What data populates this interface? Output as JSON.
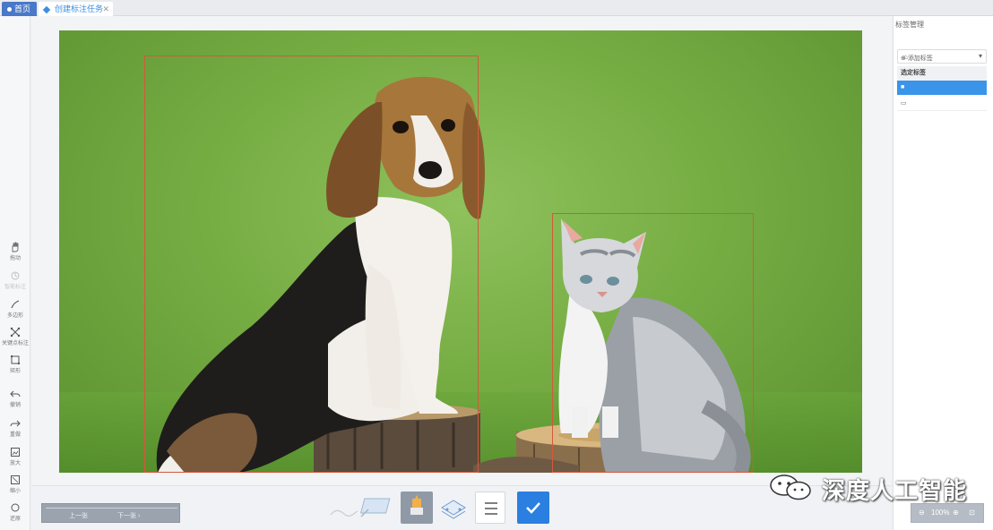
{
  "tabs": {
    "home_label": "首页",
    "task_label": "创建标注任务"
  },
  "toolbar": {
    "tools": [
      {
        "name": "hand-tool",
        "label": "拖动"
      },
      {
        "name": "smart-tool",
        "label": "智能标注"
      },
      {
        "name": "polygon-tool",
        "label": "多边形"
      },
      {
        "name": "keypoint-tool",
        "label": "关键点标注"
      },
      {
        "name": "rect-tool",
        "label": "矩形"
      },
      {
        "name": "undo-tool",
        "label": "撤销"
      },
      {
        "name": "redo-tool",
        "label": "重做"
      },
      {
        "name": "zoom-in-tool",
        "label": "放大"
      },
      {
        "name": "zoom-out-tool",
        "label": "缩小"
      },
      {
        "name": "reset-tool",
        "label": "还原"
      }
    ]
  },
  "right_panel": {
    "title": "标签管理",
    "select_value": "",
    "add_label": "添加标签",
    "section_label": "选定标签",
    "items": [
      "",
      ""
    ]
  },
  "annotations": [
    {
      "label": "dog"
    },
    {
      "label": "cat"
    }
  ],
  "bottom": {
    "prev_label": "上一张",
    "next_label": "下一张"
  },
  "zoom": {
    "value": "100%"
  },
  "watermark": {
    "text": "深度人工智能"
  },
  "colors": {
    "accent": "#2a7fe0",
    "tab_active": "#4a78c8",
    "bbox": "#d25a3c",
    "selected_row": "#3a95ea"
  }
}
